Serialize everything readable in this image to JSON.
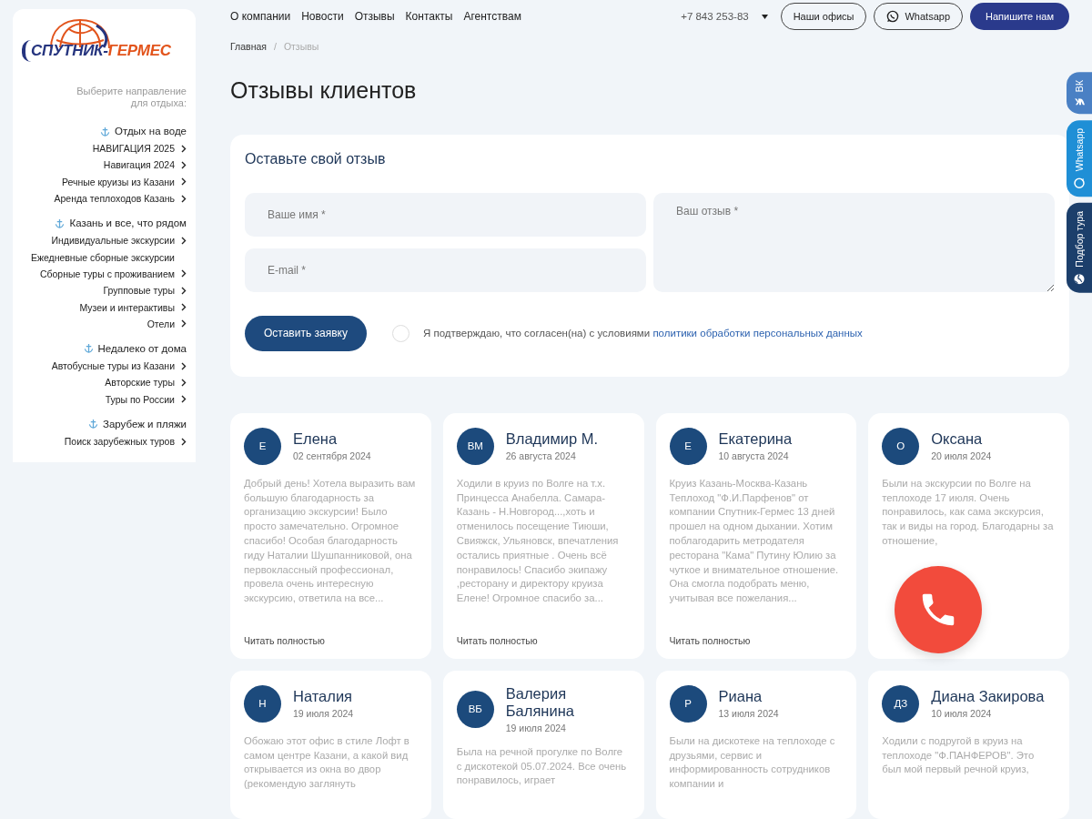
{
  "sidebar": {
    "logo": {
      "part_1": "СПУТНИК-",
      "part_2": "ГЕРМЕС"
    },
    "prompt": "Выберите направление для отдыха:",
    "groups": [
      {
        "title": "Отдых на воде",
        "items": [
          {
            "label": "НАВИГАЦИЯ 2025",
            "has_submenu": true
          },
          {
            "label": "Навигация 2024",
            "has_submenu": true
          },
          {
            "label": "Речные круизы из Казани",
            "has_submenu": true
          },
          {
            "label": "Аренда теплоходов Казань",
            "has_submenu": true
          }
        ]
      },
      {
        "title": "Казань и все, что рядом",
        "items": [
          {
            "label": "Индивидуальные экскурсии",
            "has_submenu": true
          },
          {
            "label": "Ежедневные сборные экскурсии",
            "has_submenu": false
          },
          {
            "label": "Сборные туры с проживанием",
            "has_submenu": true
          },
          {
            "label": "Групповые туры",
            "has_submenu": true
          },
          {
            "label": "Музеи и интерактивы",
            "has_submenu": true
          },
          {
            "label": "Отели",
            "has_submenu": true
          }
        ]
      },
      {
        "title": "Недалеко от дома",
        "items": [
          {
            "label": "Автобусные туры из Казани",
            "has_submenu": true
          },
          {
            "label": "Авторские туры",
            "has_submenu": true
          },
          {
            "label": "Туры по России",
            "has_submenu": true
          }
        ]
      },
      {
        "title": "Зарубеж и пляжи",
        "items": [
          {
            "label": "Поиск зарубежных туров",
            "has_submenu": true
          }
        ]
      }
    ]
  },
  "header": {
    "nav": [
      "О компании",
      "Новости",
      "Отзывы",
      "Контакты",
      "Агентствам"
    ],
    "phone": "+7 843 253-83",
    "buttons": [
      {
        "label": "Наши офисы",
        "kind": "outline"
      },
      {
        "label": "Whatsapp",
        "kind": "whatsapp"
      },
      {
        "label": "Напишите нам",
        "kind": "primary"
      }
    ]
  },
  "breadcrumbs": {
    "separator": "/",
    "items": [
      {
        "label": "Главная",
        "current": false
      },
      {
        "label": "Отзывы",
        "current": true
      }
    ]
  },
  "page_title": "Отзывы клиентов",
  "form": {
    "title": "Оставьте свой отзыв",
    "name_placeholder": "Ваше имя *",
    "email_placeholder": "E-mail *",
    "review_placeholder": "Ваш отзыв *",
    "submit": "Оставить заявку",
    "consent": {
      "checked": false,
      "text": "Я подтверждаю, что согласен(на) с условиями",
      "link": "политики обработки персональных данных"
    }
  },
  "reviews": [
    {
      "initials": "Е",
      "name": "Елена",
      "date": "02 сентября 2024",
      "text": "Добрый день! Хотела выразить вам большую благодарность за организацию экскурсии! Было просто замечательно. Огромное спасибо! Особая благодарность гиду Наталии Шушпанниковой, она первоклассный профессионал, провела очень интересную экскурсию, ответила на все...",
      "read_more": "Читать полностью"
    },
    {
      "initials": "ВМ",
      "name": "Владимир М.",
      "date": "26 августа 2024",
      "text": "Ходили в круиз по Волге на т.х. Принцесса Анабелла. Самара-Казань - Н.Новгород...,хоть и отменилось посещение Тиюши, Свияжск, Ульяновск, впечатления остались приятные . Очень всё понравилось! Спасибо экипажу ,ресторану и директору круиза Елене! Огромное спасибо за...",
      "read_more": "Читать полностью"
    },
    {
      "initials": "Е",
      "name": "Екатерина",
      "date": "10 августа 2024",
      "text": "Круиз Казань-Москва-Казань Теплоход \"Ф.И.Парфенов\" от компании Спутник-Гермес 13 дней прошел на одном дыхании. Хотим поблагодарить метродателя ресторана \"Кама\" Путину Юлию за чуткое и внимательное отношение. Она смогла подобрать меню, учитывая все пожелания...",
      "read_more": "Читать полностью"
    },
    {
      "initials": "О",
      "name": "Оксана",
      "date": "20 июля 2024",
      "text": "Были на экскурсии по Волге на теплоходе 17 июля. Очень понравилось, как сама экскурсия, так и виды на город. Благодарны за отношение,"
    },
    {
      "initials": "Н",
      "name": "Наталия",
      "date": "19 июля 2024",
      "text": "Обожаю этот офис в стиле Лофт в самом центре Казани, а какой вид открывается из окна во двор (рекомендую заглянуть"
    },
    {
      "initials": "ВБ",
      "name": "Валерия Балянина",
      "date": "19 июля 2024",
      "text": "Была на речной прогулке по Волге с дискотекой 05.07.2024. Все очень понравилось, играет"
    },
    {
      "initials": "Р",
      "name": "Риана",
      "date": "13 июля 2024",
      "text": "Были на дискотеке на теплоходе с друзьями, сервис и информированность сотрудников компании и"
    },
    {
      "initials": "ДЗ",
      "name": "Диана Закирова",
      "date": "10 июля 2024",
      "text": "Ходили с подругой в круиз на теплоходе \"Ф.ПАНФЕРОВ\". Это был мой первый речной круиз,"
    }
  ],
  "side_tabs": [
    {
      "label": "ВК",
      "kind": "vk"
    },
    {
      "label": "Whatsapp",
      "kind": "whatsapp"
    },
    {
      "label": "Подбор тура",
      "kind": "tour"
    }
  ]
}
